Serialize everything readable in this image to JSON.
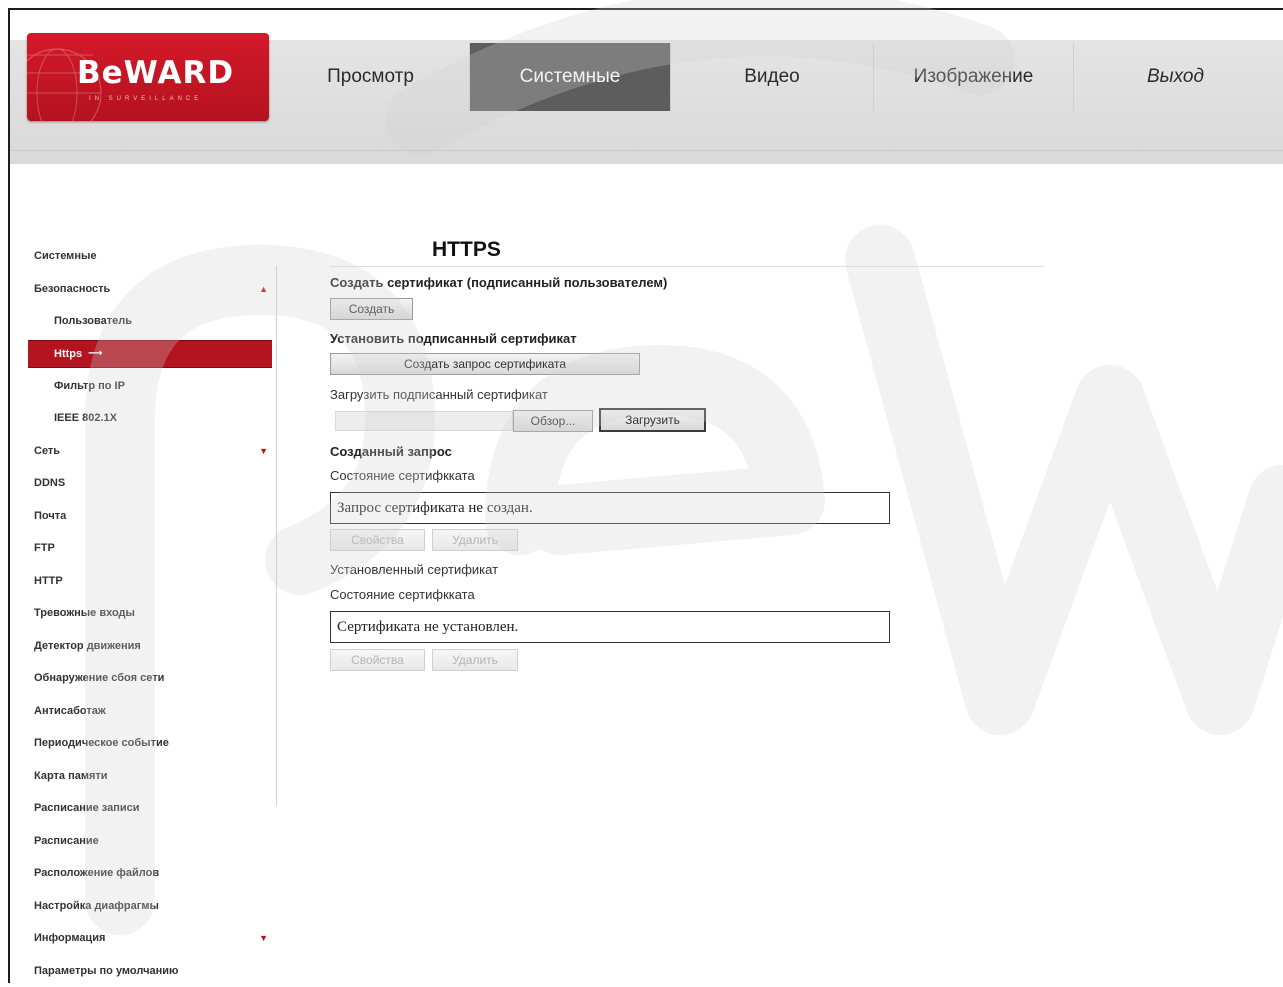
{
  "brand": {
    "logo_text": "BeWARD",
    "logo_sub": "IN SURVEILLANCE"
  },
  "nav": {
    "items": [
      {
        "label": "Просмотр",
        "active": false
      },
      {
        "label": "Системные",
        "active": true
      },
      {
        "label": "Видео",
        "active": false
      },
      {
        "label": "Изображение",
        "active": false
      },
      {
        "label": "Выход",
        "active": false
      }
    ]
  },
  "sidebar": {
    "items": [
      {
        "label": "Системные"
      },
      {
        "label": "Безопасность",
        "arrow": "▲"
      },
      {
        "label": "Пользователь"
      },
      {
        "label": "Https"
      },
      {
        "label": "Фильтр по IP"
      },
      {
        "label": "IEEE 802.1X"
      },
      {
        "label": "Сеть",
        "arrow": "▼"
      },
      {
        "label": "DDNS"
      },
      {
        "label": "Почта"
      },
      {
        "label": "FTP"
      },
      {
        "label": "HTTP"
      },
      {
        "label": "Тревожные входы"
      },
      {
        "label": "Детектор движения"
      },
      {
        "label": "Обнаружение сбоя сети"
      },
      {
        "label": "Антисаботаж"
      },
      {
        "label": "Периодическое событие"
      },
      {
        "label": "Карта памяти"
      },
      {
        "label": "Расписание записи"
      },
      {
        "label": "Расписание"
      },
      {
        "label": "Расположение файлов"
      },
      {
        "label": "Настройка диафрагмы"
      },
      {
        "label": "Информация",
        "arrow": "▼"
      },
      {
        "label": "Параметры по умолчанию"
      }
    ]
  },
  "main": {
    "title": "HTTPS",
    "create_cert": {
      "heading": "Создать сертификат (подписанный пользователем)",
      "button": "Создать"
    },
    "install_signed": {
      "heading": "Установить подписанный сертификат",
      "request_button": "Создать запрос сертификата",
      "upload_label": "Загрузить подписанный сертификат",
      "browse_button": "Обзор...",
      "upload_button": "Загрузить"
    },
    "created_request": {
      "heading": "Созданный запрос",
      "status_label": "Состояние сертифкката",
      "status_value": "Запрос сертификата не создан.",
      "props_button": "Свойства",
      "delete_button": "Удалить"
    },
    "installed_cert": {
      "heading": "Установленный сертификат",
      "status_label": "Состояние сертифкката",
      "status_value": "Сертификата не установлен.",
      "props_button": "Свойства",
      "delete_button": "Удалить"
    }
  },
  "colors": {
    "accent": "#b3141f",
    "nav_active": "#5d5d5d",
    "header_bg": "#e0e0e0"
  }
}
